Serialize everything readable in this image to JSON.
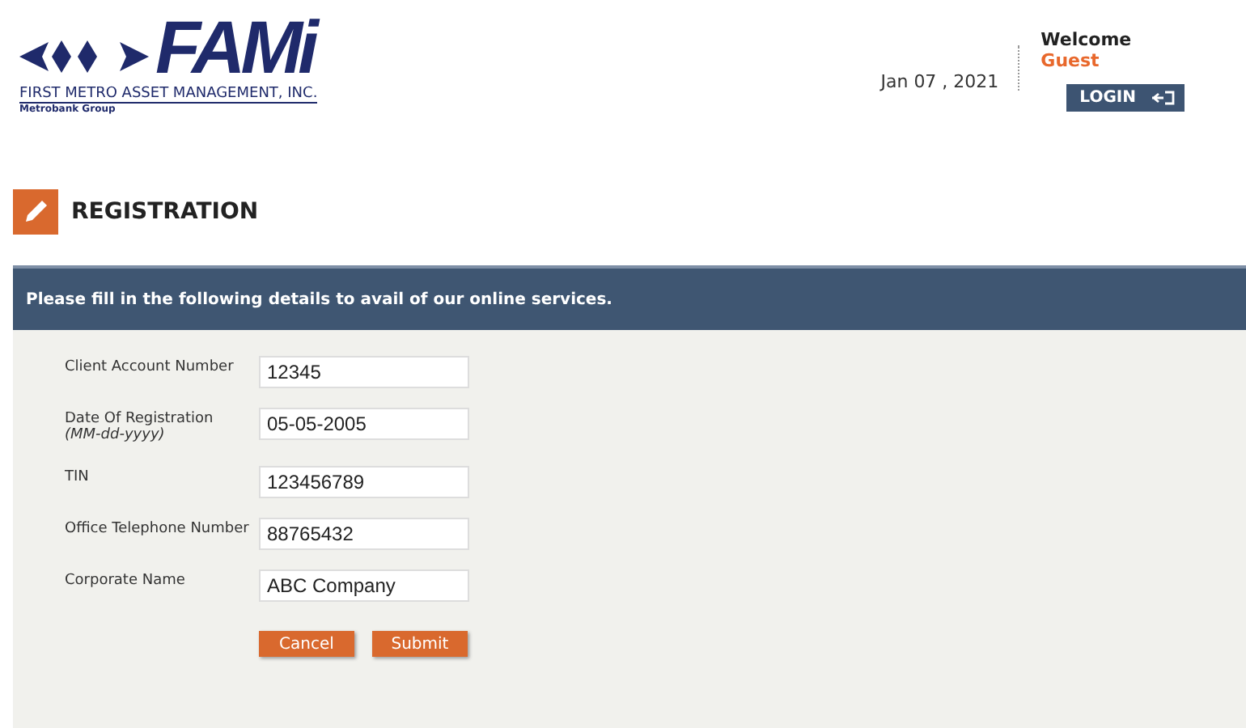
{
  "logo": {
    "mark": "FAMi",
    "company": "FIRST METRO ASSET MANAGEMENT, INC.",
    "group": "Metrobank Group"
  },
  "header": {
    "date": "Jan 07 , 2021",
    "welcome": "Welcome",
    "user": "Guest",
    "login": "LOGIN"
  },
  "page_title": "REGISTRATION",
  "banner": "Please fill in the following details to avail of our online services.",
  "fields": [
    {
      "label": "Client Account Number",
      "value": "12345"
    },
    {
      "label": "Date Of Registration",
      "hint": "(MM-dd-yyyy)",
      "value": "05-05-2005"
    },
    {
      "label": "TIN",
      "value": "123456789"
    },
    {
      "label": "Office Telephone Number",
      "value": "88765432"
    },
    {
      "label": "Corporate Name",
      "value": "ABC Company"
    }
  ],
  "buttons": [
    "Cancel",
    "Submit"
  ]
}
